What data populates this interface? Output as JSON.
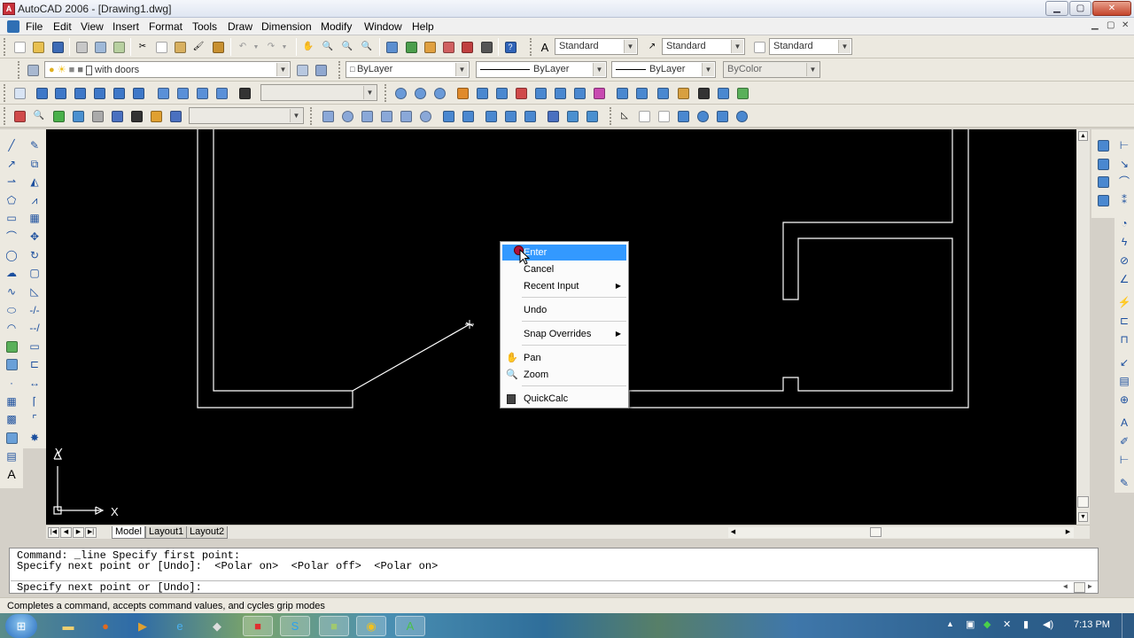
{
  "window": {
    "title": "AutoCAD 2006 - [Drawing1.dwg]",
    "app_icon": "autocad-logo-icon",
    "buttons": [
      "minimize",
      "maximize",
      "close"
    ]
  },
  "menubar": {
    "items": [
      "File",
      "Edit",
      "View",
      "Insert",
      "Format",
      "Tools",
      "Draw",
      "Dimension",
      "Modify",
      "Window",
      "Help"
    ]
  },
  "toolbars": {
    "text_style": "Standard",
    "dim_style": "Standard",
    "table_style": "Standard",
    "layer": "with doors",
    "color": "ByLayer",
    "linetype": "ByLayer",
    "lineweight": "ByLayer",
    "plot_style": "ByColor"
  },
  "axes": {
    "y_label": "Y",
    "x_label": "X"
  },
  "layout_tabs": {
    "tabs": [
      "Model",
      "Layout1",
      "Layout2"
    ],
    "active": "Model"
  },
  "context_menu": {
    "items": [
      {
        "label": "Enter",
        "highlighted": true
      },
      {
        "label": "Cancel"
      },
      {
        "label": "Recent Input",
        "submenu": true
      },
      {
        "label": "Undo"
      },
      {
        "label": "Snap Overrides",
        "submenu": true
      },
      {
        "label": "Pan",
        "icon": "pan-icon"
      },
      {
        "label": "Zoom",
        "icon": "zoom-icon"
      },
      {
        "label": "QuickCalc",
        "icon": "calculator-icon"
      }
    ]
  },
  "command": {
    "history": [
      "Command: _line Specify first point:",
      "Specify next point or [Undo]:  <Polar on>  <Polar off>  <Polar on>"
    ],
    "prompt": "Specify next point or [Undo]:"
  },
  "status": {
    "text": "Completes a command, accepts command values, and cycles grip modes"
  },
  "taskbar": {
    "clock": "7:13 PM"
  },
  "colors": {
    "canvas": "#000000",
    "geometry": "#ffffff",
    "menu_highlight": "#3399ff",
    "toolbar_bg": "#ece9e0"
  }
}
